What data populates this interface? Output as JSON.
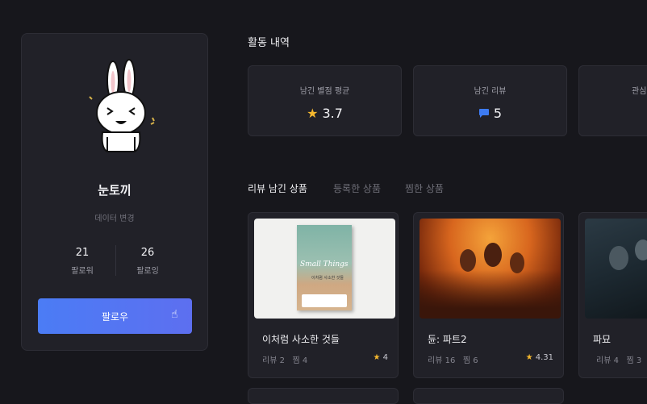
{
  "profile": {
    "nickname": "눈토끼",
    "edit_label": "데이터 변경",
    "followers": {
      "count": "21",
      "label": "팔로워"
    },
    "following": {
      "count": "26",
      "label": "팔로잉"
    },
    "follow_button": "팔로우"
  },
  "activity": {
    "title": "활동 내역",
    "cards": [
      {
        "label": "남긴 별점 평균",
        "value": "3.7",
        "icon": "star-icon"
      },
      {
        "label": "남긴 리뷰",
        "value": "5",
        "icon": "comment-icon"
      },
      {
        "label": "관심",
        "value": ""
      }
    ]
  },
  "tabs": [
    {
      "label": "리뷰 남긴 상품",
      "active": true
    },
    {
      "label": "등록한 상품",
      "active": false
    },
    {
      "label": "찜한 상품",
      "active": false
    }
  ],
  "products": [
    {
      "name": "이처럼 사소한 것들",
      "reviews": "리뷰 2",
      "likes": "찜 4",
      "rating": "4",
      "cover_title": "Small Things",
      "cover_subtitle": "이처럼 사소한 것들"
    },
    {
      "name": "듄: 파트2",
      "reviews": "리뷰 16",
      "likes": "찜 6",
      "rating": "4.31"
    },
    {
      "name": "파묘",
      "reviews": "리뷰 4",
      "likes": "찜 3",
      "rating": ""
    }
  ],
  "colors": {
    "accent": "#4b7cf5",
    "star": "#f5b82e",
    "card": "#212128",
    "background": "#17171c"
  }
}
